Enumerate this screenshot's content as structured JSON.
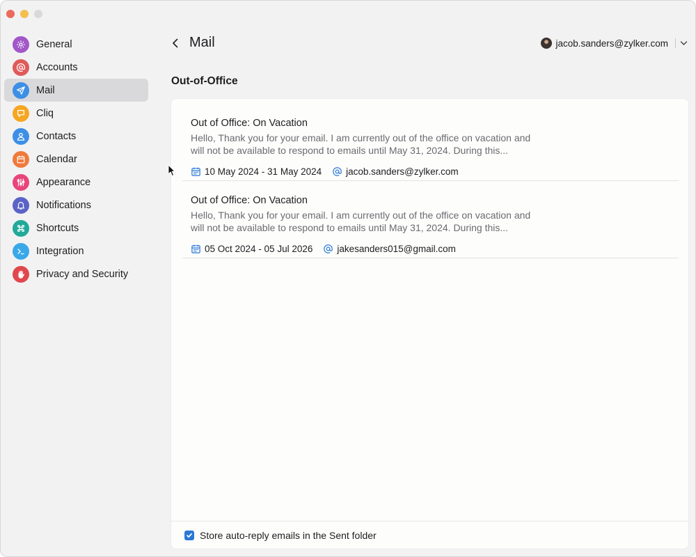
{
  "window": {
    "traffic_lights": [
      "close",
      "minimize",
      "maximize"
    ]
  },
  "sidebar": {
    "items": [
      {
        "label": "General",
        "icon": "gear-icon",
        "color": "#a257c9"
      },
      {
        "label": "Accounts",
        "icon": "at-icon",
        "color": "#e05a5a"
      },
      {
        "label": "Mail",
        "icon": "paper-plane-icon",
        "color": "#3d8fe6",
        "active": true
      },
      {
        "label": "Cliq",
        "icon": "chat-icon",
        "color": "#f5a623"
      },
      {
        "label": "Contacts",
        "icon": "person-icon",
        "color": "#3d8fe6"
      },
      {
        "label": "Calendar",
        "icon": "calendar-icon",
        "color": "#f07a3c"
      },
      {
        "label": "Appearance",
        "icon": "sliders-icon",
        "color": "#e8457a"
      },
      {
        "label": "Notifications",
        "icon": "bell-icon",
        "color": "#5b63c7"
      },
      {
        "label": "Shortcuts",
        "icon": "command-icon",
        "color": "#23a99a"
      },
      {
        "label": "Integration",
        "icon": "terminal-icon",
        "color": "#3aa8e8"
      },
      {
        "label": "Privacy and Security",
        "icon": "hand-icon",
        "color": "#e0484d"
      }
    ]
  },
  "header": {
    "title": "Mail",
    "account_email": "jacob.sanders@zylker.com"
  },
  "section": {
    "title": "Out-of-Office"
  },
  "ooo_items": [
    {
      "title": "Out of Office: On Vacation",
      "message": "Hello,  Thank you for your email. I am currently out of the office on vacation and will not be available to respond to emails until May 31, 2024. During this...",
      "dates": "10 May 2024 - 31 May 2024",
      "email": "jacob.sanders@zylker.com"
    },
    {
      "title": "Out of Office: On Vacation",
      "message": "Hello,  Thank you for your email. I am currently out of the office on vacation and will not be available to respond to emails until May 31, 2024. During this...",
      "dates": "05 Oct 2024 - 05 Jul 2026",
      "email": "jakesanders015@gmail.com"
    }
  ],
  "footer": {
    "store_label": "Store auto-reply emails in the Sent folder",
    "store_checked": true
  },
  "colors": {
    "accent": "#2a78d6",
    "meta_icon": "#2a78d6"
  }
}
